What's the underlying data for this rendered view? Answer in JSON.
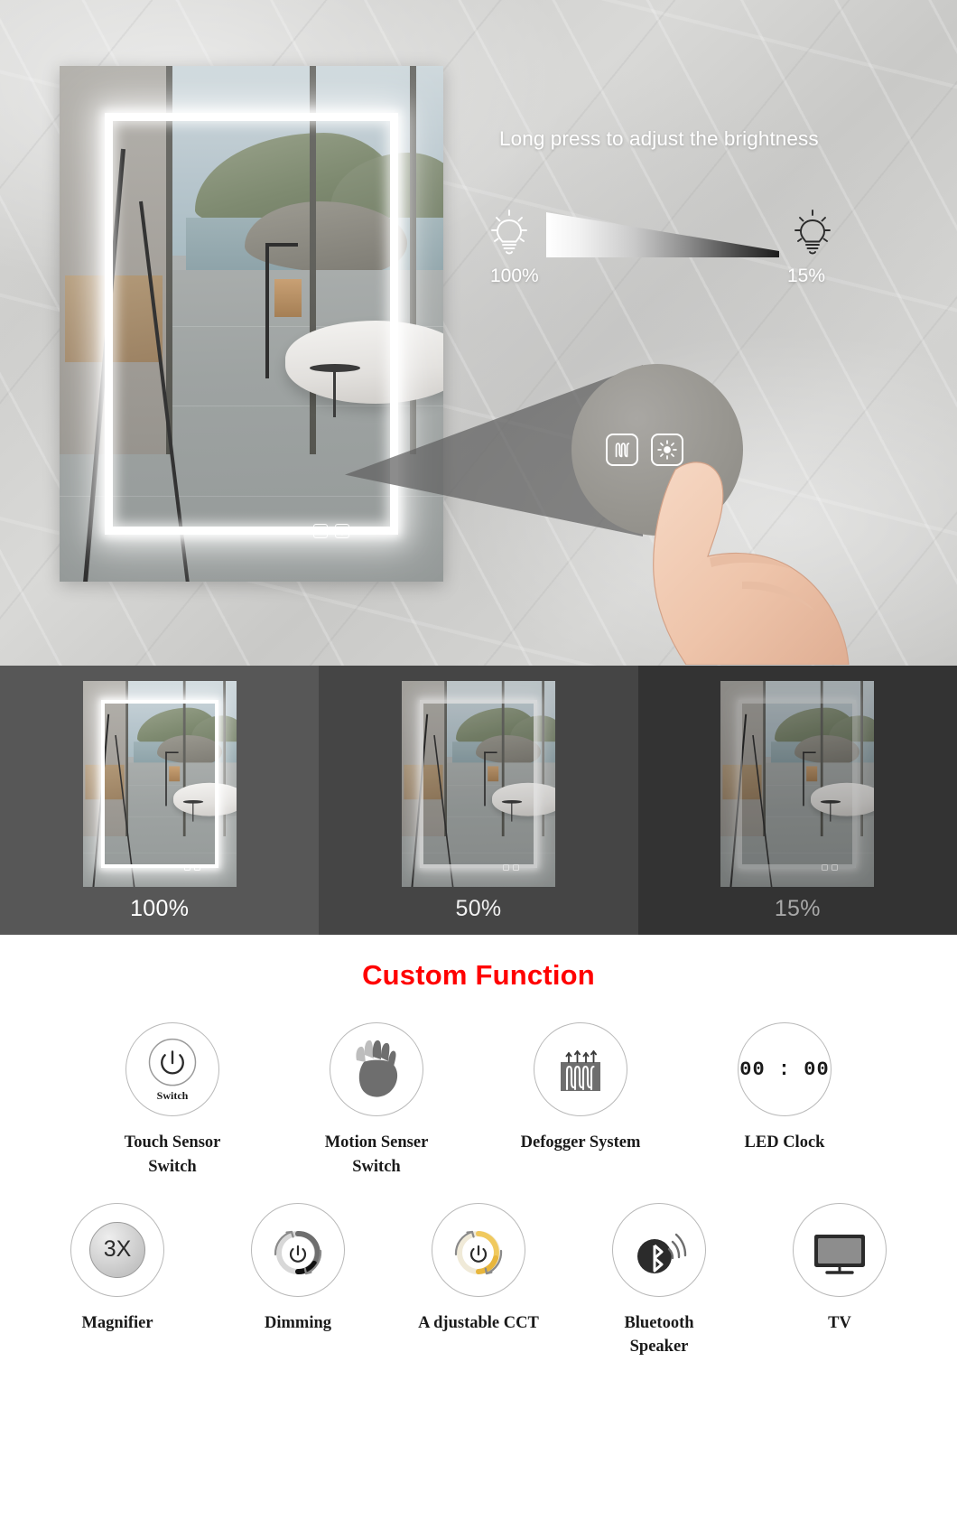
{
  "hero": {
    "title": "Long press to adjust the brightness",
    "brightness_max_label": "100%",
    "brightness_min_label": "15%",
    "bulb_bright_icon": "lightbulb-bright-icon",
    "bulb_dim_icon": "lightbulb-dim-icon",
    "gradient_icon": "brightness-gradient-wedge",
    "mirror_buttons": [
      {
        "icon": "defogger-icon",
        "name": "defogger-touch-button"
      },
      {
        "icon": "brightness-icon",
        "name": "brightness-touch-button"
      }
    ],
    "magnified_buttons": [
      {
        "icon": "defogger-icon",
        "label": "defogger-button"
      },
      {
        "icon": "brightness-icon",
        "label": "brightness-button"
      }
    ],
    "hand_icon": "hand-pointing-icon"
  },
  "comparison": {
    "panels": [
      {
        "label": "100%",
        "bg": "#575757",
        "led_opacity": 1.0,
        "label_color": "#ffffff"
      },
      {
        "label": "50%",
        "bg": "#454545",
        "led_opacity": 0.72,
        "label_color": "#f0f0f0"
      },
      {
        "label": "15%",
        "bg": "#333333",
        "led_opacity": 0.42,
        "label_color": "#a8a8a8"
      }
    ]
  },
  "custom": {
    "title": "Custom Function",
    "title_color": "#ff0000",
    "row1": [
      {
        "label": "Touch Sensor\nSwitch",
        "icon": "power-switch-icon",
        "inner_text": "Switch"
      },
      {
        "label": "Motion Senser\nSwitch",
        "icon": "waving-hand-icon",
        "inner_text": ""
      },
      {
        "label": "Defogger System",
        "icon": "defogger-heater-icon",
        "inner_text": ""
      },
      {
        "label": "LED Clock",
        "icon": "led-clock-icon",
        "inner_text": "00 : 00"
      }
    ],
    "row2": [
      {
        "label": "Magnifier",
        "icon": "magnifier-icon",
        "inner_text": "3X"
      },
      {
        "label": "Dimming",
        "icon": "dimming-ring-icon",
        "inner_text": ""
      },
      {
        "label": "A djustable CCT",
        "icon": "cct-ring-icon",
        "inner_text": ""
      },
      {
        "label": "Bluetooth\nSpeaker",
        "icon": "bluetooth-speaker-icon",
        "inner_text": ""
      },
      {
        "label": "TV",
        "icon": "tv-icon",
        "inner_text": ""
      }
    ]
  }
}
